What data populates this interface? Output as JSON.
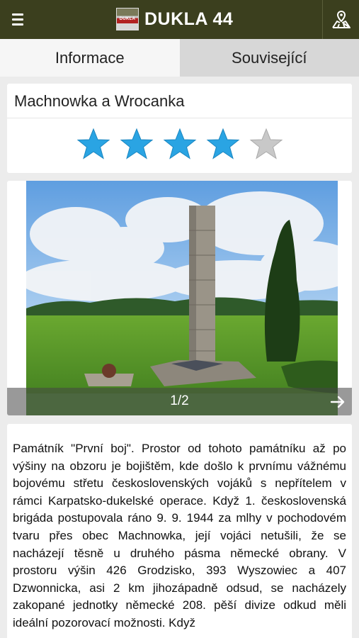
{
  "app": {
    "title": "DUKLA 44",
    "logo_text": "DUKLA",
    "icons": {
      "menu": "hamburger-menu-icon",
      "map": "map-pin-icon",
      "next": "arrow-right-icon",
      "star": "star-icon"
    }
  },
  "tabs": [
    {
      "label": "Informace",
      "active": true
    },
    {
      "label": "Související",
      "active": false
    }
  ],
  "place": {
    "title": "Machnowka a Wrocanka",
    "rating": 4,
    "rating_max": 5
  },
  "gallery": {
    "counter": "1/2"
  },
  "description": "Památník \"První boj\". Prostor od tohoto památníku až po výšiny na obzoru je bojištěm, kde došlo k prvnímu vážnému bojovému střetu československých vojáků s nepřítelem v rámci Karpatsko-dukelské operace. Když 1. československá brigáda postupovala ráno 9. 9. 1944 za mlhy v pochodovém tvaru přes obec Machnowka, její vojáci netušili, že se nacházejí těsně u druhého pásma německé obrany. V prostoru výšin 426 Grodzisko, 393 Wyszowiec a 407 Dzwonnicka, asi 2 km jihozápadně odsud, se nacházely zakopané jednotky německé 208. pěší divize odkud měli ideální pozorovací možnosti. Když",
  "colors": {
    "appbar": "#3b3f1e",
    "star_filled": "#2aa4e3",
    "star_empty": "#c8c8c8",
    "background": "#ececec"
  }
}
